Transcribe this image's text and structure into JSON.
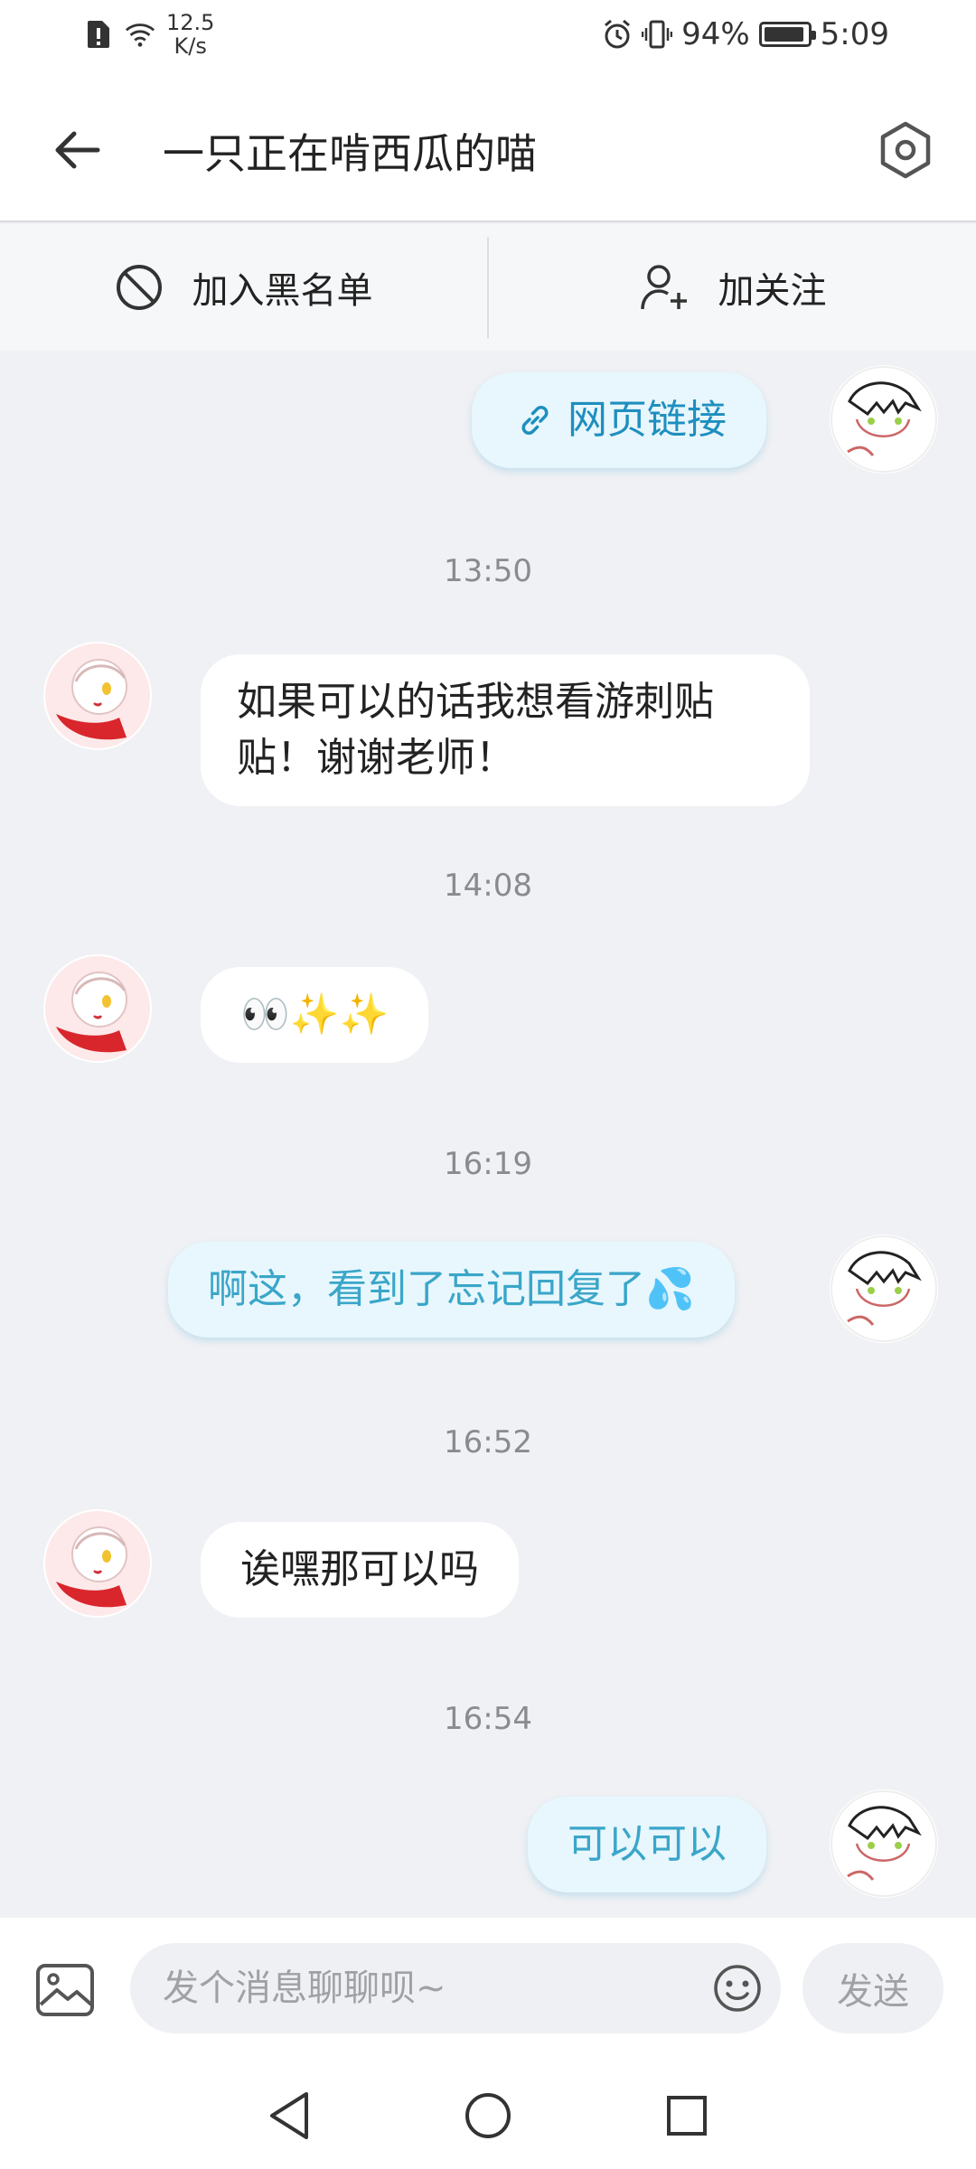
{
  "status_bar": {
    "net_speed_value": "12.5",
    "net_speed_unit": "K/s",
    "battery_percent": "94%",
    "battery_level": 0.94,
    "time": "5:09"
  },
  "header": {
    "title": "一只正在啃西瓜的喵"
  },
  "actions": {
    "blacklist_label": "加入黑名单",
    "follow_label": "加关注"
  },
  "messages": [
    {
      "direction": "out",
      "text": "网页链接",
      "link_icon": "link-icon"
    },
    {
      "timestamp": "13:50"
    },
    {
      "direction": "in",
      "text_line1": "如果可以的话我想看游刺贴",
      "text_line2": "贴！谢谢老师！"
    },
    {
      "timestamp": "14:08"
    },
    {
      "direction": "in",
      "text": "👀✨✨"
    },
    {
      "timestamp": "16:19"
    },
    {
      "direction": "out",
      "text": "啊这，看到了忘记回复了💦"
    },
    {
      "timestamp": "16:52"
    },
    {
      "direction": "in",
      "text": "诶嘿那可以吗"
    },
    {
      "timestamp": "16:54"
    },
    {
      "direction": "out",
      "text": "可以可以"
    }
  ],
  "input": {
    "placeholder": "发个消息聊聊呗~",
    "send_label": "发送"
  },
  "colors": {
    "out_bubble_bg": "#e8f7fd",
    "out_bubble_text": "#3aa6c9",
    "link_text": "#1e8fbf",
    "background": "#f0f1f4"
  }
}
